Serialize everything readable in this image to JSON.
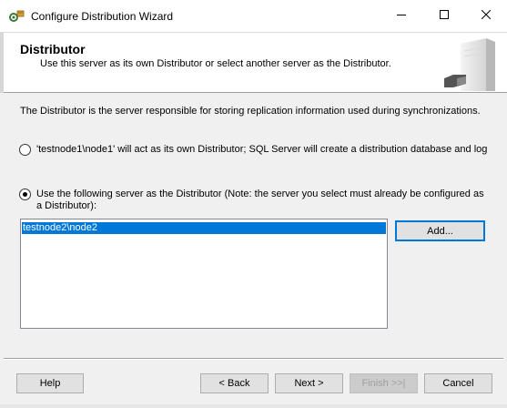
{
  "window": {
    "title": "Configure Distribution Wizard",
    "app_icon": "wizard-gear-icon",
    "controls": [
      "minimize-icon",
      "maximize-icon",
      "close-icon"
    ]
  },
  "header": {
    "title": "Distributor",
    "subtitle": "Use this server as its own Distributor or select another server as the Distributor.",
    "graphic": "server-tower-icon"
  },
  "body": {
    "intro": "The Distributor is the server responsible for storing replication information used during synchronizations.",
    "option1": {
      "label": "'testnode1\\node1' will act as its own Distributor; SQL Server will create a distribution database and log",
      "checked": false
    },
    "option2": {
      "label": "Use the following server as the Distributor (Note: the server you select must already be configured as a Distributor):",
      "checked": true
    },
    "servers": [
      "testnode2\\node2"
    ],
    "selected_server": "testnode2\\node2",
    "add_button": "Add..."
  },
  "footer": {
    "help": "Help",
    "back": "< Back",
    "next": "Next >",
    "finish": "Finish >>|",
    "cancel": "Cancel"
  },
  "colors": {
    "selection": "#0078d7",
    "window_bg": "#f0f0f0",
    "header_bg": "#ffffff"
  }
}
